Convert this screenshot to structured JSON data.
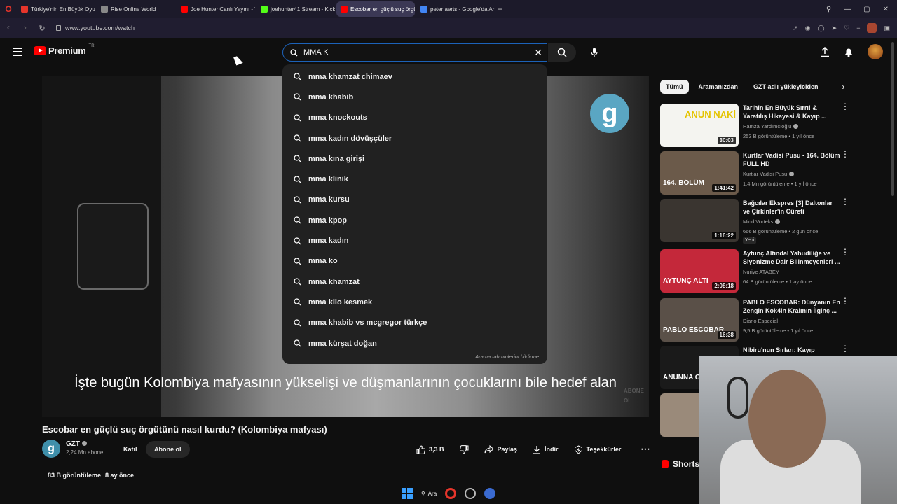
{
  "browser": {
    "tabs": [
      {
        "title": "Türkiye'nin En Büyük Oyun",
        "favicon": "opera",
        "color": "#e6352b"
      },
      {
        "title": "Rise Online World",
        "favicon": "r",
        "color": "#888888"
      },
      {
        "title": "Joe Hunter Canlı Yayını - Y",
        "favicon": "youtube",
        "color": "#ff0000"
      },
      {
        "title": "joehunter41 Stream - Kick",
        "favicon": "kick",
        "color": "#53fc18"
      },
      {
        "title": "Escobar en güçlü suç örgü",
        "favicon": "youtube",
        "color": "#ff0000",
        "active": true
      },
      {
        "title": "peter aerts - Google'da Ar",
        "favicon": "google",
        "color": "#4285f4"
      }
    ],
    "url": "www.youtube.com/watch"
  },
  "header": {
    "logo_text": "Premium",
    "region": "TR",
    "search_value": "MMA K"
  },
  "suggestions": [
    "mma khamzat chimaev",
    "mma khabib",
    "mma knockouts",
    "mma kadın dövüşçüler",
    "mma kına girişi",
    "mma klinik",
    "mma kursu",
    "mma kpop",
    "mma kadın",
    "mma ko",
    "mma khamzat",
    "mma kilo kesmek",
    "mma khabib vs mcgregor türkçe",
    "mma kürşat doğan"
  ],
  "suggest_report": "Arama tahminlerini bildirme",
  "video": {
    "subtitle": "İşte bugün Kolombiya mafyasının yükselişi ve düşmanlarının çocuklarını bile hedef alan",
    "logo_letter": "g",
    "watermark": "ABONE\nOL",
    "title": "Escobar en güçlü suç örgütünü nasıl kurdu? (Kolombiya mafyası)",
    "channel": "GZT",
    "channel_letter": "g",
    "subscribers": "2,24 Mn abone",
    "join": "Katıl",
    "subscribe": "Abone ol",
    "likes": "3,3 B",
    "share": "Paylaş",
    "download": "İndir",
    "thanks": "Teşekkürler",
    "views": "83 B görüntüleme",
    "age": "8 ay önce"
  },
  "chips": [
    "Tümü",
    "Aramanızdan",
    "GZT adlı yükleyiciden"
  ],
  "recommendations": [
    {
      "title": "Tarihin En Büyük Sırrı! & Yaratılış Hikayesi & Kayıp ...",
      "channel": "Hamza Yardımcıoğlu",
      "verified": true,
      "meta": "253 B görüntüleme • 1 yıl önce",
      "duration": "30:03",
      "thumb_color": "#f4f4f0",
      "thumb_text": "ANUN NAKİ",
      "badge": ""
    },
    {
      "title": "Kurtlar Vadisi Pusu - 164. Bölüm FULL HD",
      "channel": "Kurtlar Vadisi Pusu",
      "verified": true,
      "meta": "1,4 Mn görüntüleme • 1 yıl önce",
      "duration": "1:41:42",
      "thumb_color": "#6b5a4a",
      "thumb_text": "164. BÖLÜM",
      "badge": ""
    },
    {
      "title": "Bağcılar Ekspres [3] Daltonlar ve Çirkinler'in Cüreti",
      "channel": "Mind Vorteks",
      "verified": true,
      "meta": "666 B görüntüleme • 2 gün önce",
      "duration": "1:16:22",
      "thumb_color": "#3a3530",
      "thumb_text": "",
      "badge": "Yeni"
    },
    {
      "title": "Aytunç Altındal Yahudiliğe ve Siyonizme Dair Bilinmeyenleri ...",
      "channel": "Nuriye ATABEY",
      "verified": false,
      "meta": "64 B görüntüleme • 1 ay önce",
      "duration": "2:08:18",
      "thumb_color": "#c4283a",
      "thumb_text": "AYTUNÇ ALTI",
      "badge": ""
    },
    {
      "title": "PABLO ESCOBAR: Dünyanın En Zengin Kok4in Kralının İlginç ...",
      "channel": "Diario Especial",
      "verified": false,
      "meta": "9,5 B görüntüleme • 1 yıl önce",
      "duration": "16:38",
      "thumb_color": "#5a5048",
      "thumb_text": "PABLO ESCOBAR",
      "badge": ""
    },
    {
      "title": "Nibiru'nun Sırları: Kayıp",
      "channel": "",
      "verified": false,
      "meta": "",
      "duration": "",
      "thumb_color": "#1a1a1a",
      "thumb_text": "ANUNNA GEZEGEN",
      "badge": ""
    },
    {
      "title": "",
      "channel": "",
      "verified": false,
      "meta": "",
      "duration": "",
      "thumb_color": "#9a8a7a",
      "thumb_text": "",
      "badge": ""
    }
  ],
  "shorts_label": "Shorts",
  "taskbar": {
    "search_label": "Ara"
  }
}
